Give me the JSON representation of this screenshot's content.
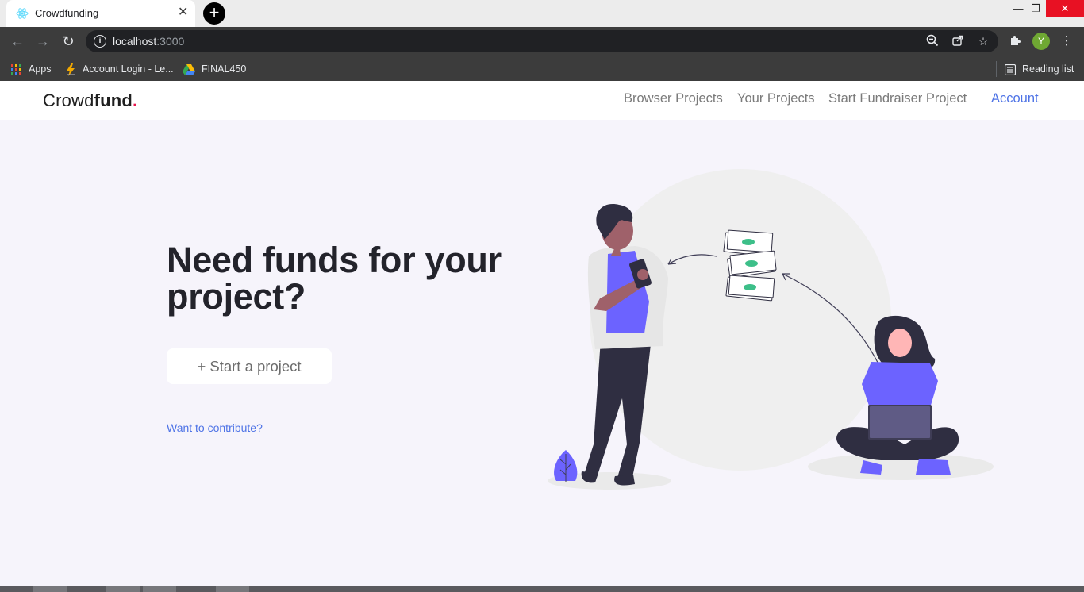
{
  "browser": {
    "tab_title": "Crowdfunding",
    "url_host": "localhost",
    "url_port": ":3000",
    "profile_initial": "Y",
    "bookmarks": [
      {
        "label": "Apps"
      },
      {
        "label": "Account Login - Le..."
      },
      {
        "label": "FINAL450"
      }
    ],
    "reading_list": "Reading list"
  },
  "navbar": {
    "brand_light": "Crowd",
    "brand_bold": "fund",
    "brand_dot": ".",
    "links": [
      "Browser Projects",
      "Your Projects",
      "Start Fundraiser Project"
    ],
    "account": "Account"
  },
  "hero": {
    "title": "Need funds for your project?",
    "start_button": "+ Start a project",
    "contribute_link": "Want to contribute?"
  },
  "colors": {
    "accent_blue": "#4e73e6",
    "brand_dot": "#e8144c",
    "illustration_purple": "#6c63ff",
    "page_bg": "#f6f4fb"
  }
}
